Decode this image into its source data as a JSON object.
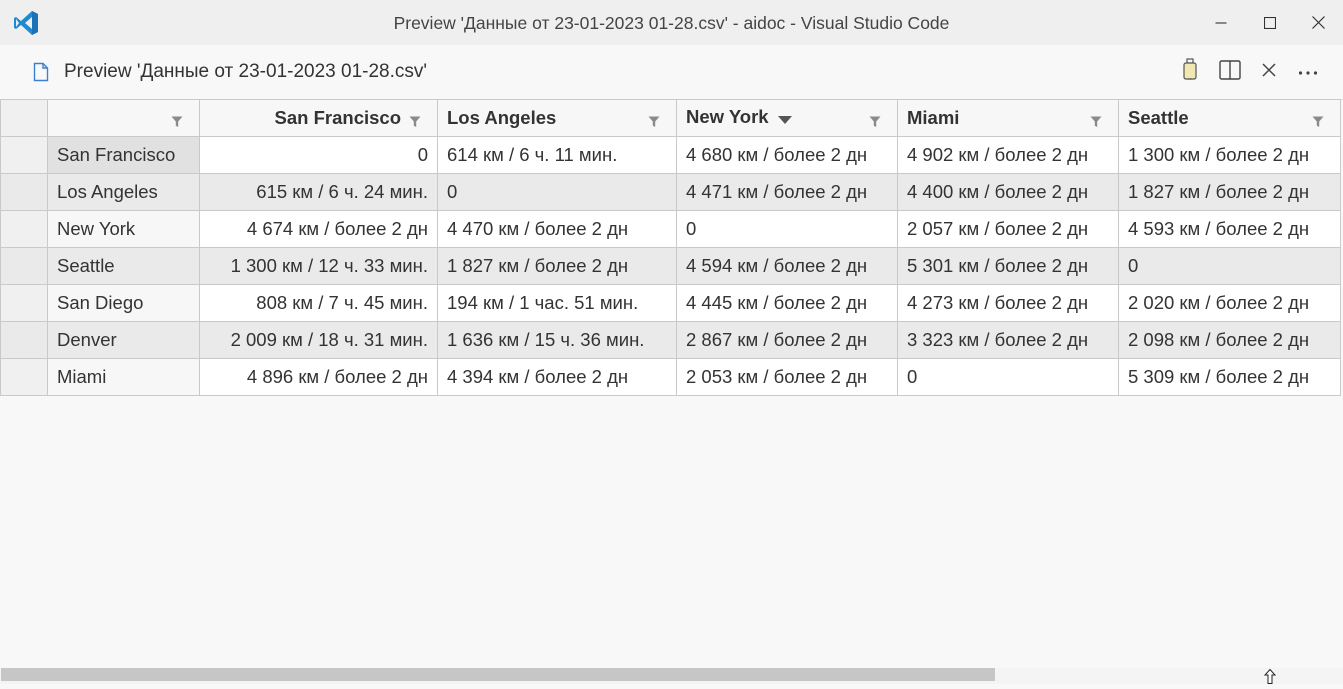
{
  "window": {
    "title": "Preview 'Данные от 23-01-2023 01-28.csv' - aidoc - Visual Studio Code",
    "buttons": [
      "minimize-icon",
      "maximize-icon",
      "close-icon"
    ]
  },
  "tab": {
    "label": "Preview 'Данные от 23-01-2023 01-28.csv'",
    "icon": "file-icon",
    "toolbar": [
      "device-icon",
      "split-editor-icon",
      "close-icon",
      "more-actions-icon"
    ]
  },
  "grid": {
    "columns": [
      {
        "label": "",
        "filter": true
      },
      {
        "label": "San Francisco",
        "filter": true
      },
      {
        "label": "Los Angeles",
        "filter": true
      },
      {
        "label": "New York",
        "filter": true,
        "sorted": "descending"
      },
      {
        "label": "Miami",
        "filter": true
      },
      {
        "label": "Seattle",
        "filter": true
      }
    ],
    "rows": [
      {
        "city": "San Francisco",
        "values": [
          "0",
          "614 км / 6 ч. 11 мин.",
          "4 680 км / более 2 дн",
          "4 902 км / более 2 дн",
          "1 300 км / более 2 дн"
        ]
      },
      {
        "city": "Los Angeles",
        "values": [
          "615 км / 6 ч. 24 мин.",
          "0",
          "4 471 км / более 2 дн",
          "4 400 км / более 2 дн",
          "1 827 км / более 2 дн"
        ]
      },
      {
        "city": "New York",
        "values": [
          "4 674 км / более 2 дн",
          "4 470 км / более 2 дн",
          "0",
          "2 057 км / более 2 дн",
          "4 593 км / более 2 дн"
        ]
      },
      {
        "city": "Seattle",
        "values": [
          "1 300 км / 12 ч. 33 мин.",
          "1 827 км / более 2 дн",
          "4 594 км / более 2 дн",
          "5 301 км / более 2 дн",
          "0"
        ]
      },
      {
        "city": "San Diego",
        "values": [
          "808 км / 7 ч. 45 мин.",
          "194 км / 1 час. 51 мин.",
          "4 445 км / более 2 дн",
          "4 273 км / более 2 дн",
          "2 020 км / более 2 дн"
        ]
      },
      {
        "city": "Denver",
        "values": [
          "2 009 км / 18 ч. 31 мин.",
          "1 636 км / 15 ч. 36 мин.",
          "2 867 км / более 2 дн",
          "3 323 км / более 2 дн",
          "2 098 км / более 2 дн"
        ]
      },
      {
        "city": "Miami",
        "values": [
          "4 896 км / более 2 дн",
          "4 394 км / более 2 дн",
          "2 053 км / более 2 дн",
          "0",
          "5 309 км / более 2 дн"
        ]
      }
    ],
    "selected_cell": "San Francisco"
  },
  "colors": {
    "vscode_blue": "#1f8ad2",
    "titlebar_bg": "#efefef",
    "grid_border": "#c9c9c9",
    "alt_row": "#eaeaea"
  }
}
